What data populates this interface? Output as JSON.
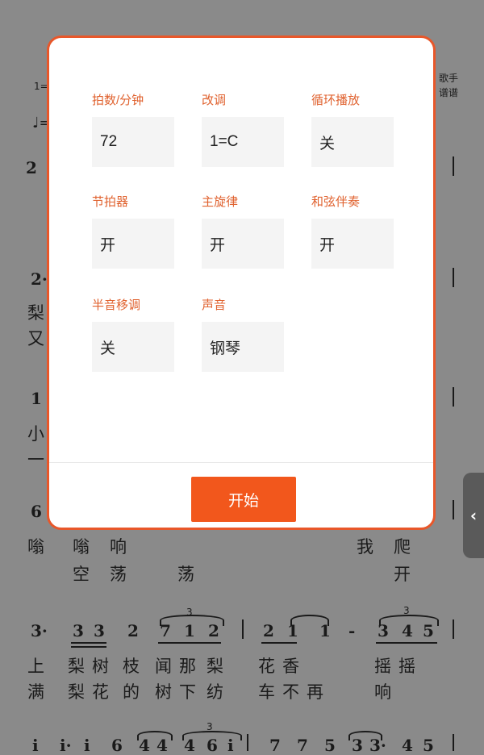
{
  "settings": [
    {
      "label": "拍数/分钟",
      "value": "72"
    },
    {
      "label": "改调",
      "value": "1=C"
    },
    {
      "label": "循环播放",
      "value": "关"
    },
    {
      "label": "节拍器",
      "value": "开"
    },
    {
      "label": "主旋律",
      "value": "开"
    },
    {
      "label": "和弦伴奏",
      "value": "开"
    },
    {
      "label": "半音移调",
      "value": "关"
    },
    {
      "label": "声音",
      "value": "钢琴"
    }
  ],
  "start_button": "开始",
  "side_handle_icon": "chevron-left-icon",
  "colors": {
    "accent": "#f2571c",
    "label": "#e0622f",
    "overlay": "#8a8a8a"
  },
  "score": {
    "header_key": "1=",
    "header_tempo": "♩=",
    "top_right_1": "歌手",
    "top_right_2": "谱谱",
    "line1_num": "2",
    "line2_num": "2·",
    "line2_lyric_a": "梨",
    "line2_lyric_b": "又",
    "line3_num": "1",
    "line3_lyric_a": "小",
    "line3_lyric_b": "一",
    "line4_num": "6",
    "line4_lyrics_a": [
      "嗡",
      "嗡",
      "响",
      "我",
      "爬"
    ],
    "line4_lyrics_b": [
      "空",
      "荡",
      "荡",
      "开"
    ],
    "line5_notes": [
      "3·",
      "3",
      "3",
      "2",
      "7",
      "1",
      "2",
      "2",
      "1",
      "1",
      "-",
      "3",
      "4",
      "5"
    ],
    "line5_lyrics_a": [
      "上",
      "梨",
      "树",
      "枝",
      "闻",
      "那",
      "梨",
      "花",
      "香",
      "摇",
      "摇"
    ],
    "line5_lyrics_b": [
      "满",
      "梨",
      "花",
      "的",
      "树",
      "下",
      "纺",
      "车",
      "不",
      "再",
      "响"
    ],
    "line6_notes": [
      "i",
      "i·",
      "i",
      "6",
      "4",
      "4",
      "4",
      "6",
      "i",
      "7",
      "7",
      "5",
      "3",
      "3·",
      "4",
      "5"
    ],
    "triplet_mark": "3"
  }
}
